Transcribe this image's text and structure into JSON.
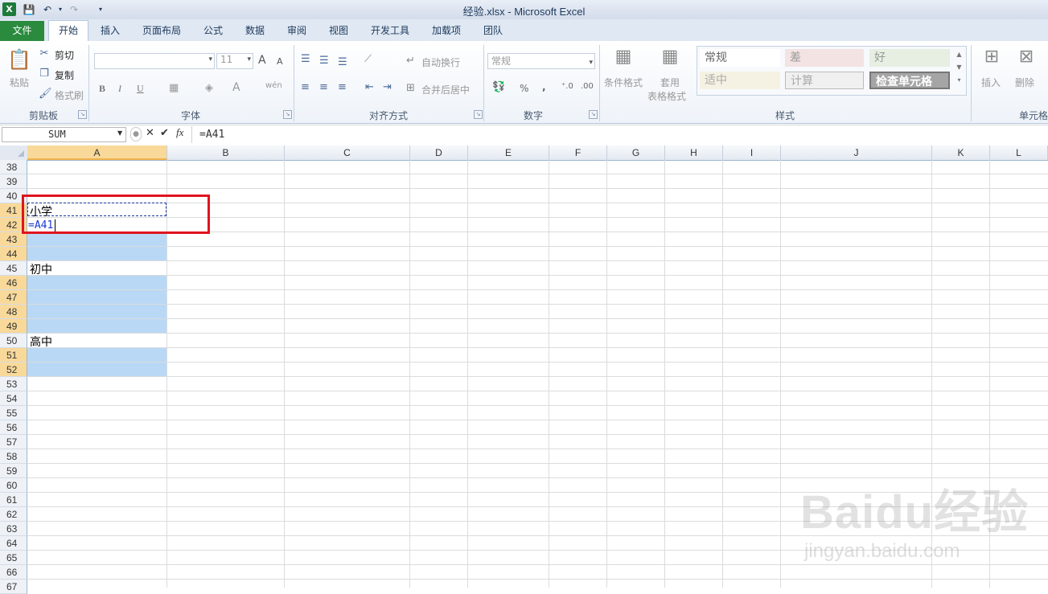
{
  "window": {
    "title": "经验.xlsx - Microsoft Excel"
  },
  "quick_access": {
    "logo": "X",
    "save": "💾",
    "undo": "↶",
    "redo": "↷"
  },
  "tabs": [
    "文件",
    "开始",
    "插入",
    "页面布局",
    "公式",
    "数据",
    "审阅",
    "视图",
    "开发工具",
    "加载项",
    "团队"
  ],
  "ribbon": {
    "clipboard": {
      "paste": "粘贴",
      "cut": "剪切",
      "copy": "复制",
      "format_painter": "格式刷",
      "label": "剪贴板"
    },
    "font": {
      "font_name": "",
      "font_size": "11",
      "bold": "B",
      "italic": "I",
      "underline": "U",
      "label": "字体",
      "grow": "A",
      "shrink": "A",
      "color_a": "A",
      "phonetic": "wén"
    },
    "alignment": {
      "wrap": "自动换行",
      "merge": "合并后居中",
      "label": "对齐方式"
    },
    "number": {
      "format": "常规",
      "percent": "%",
      "comma": ",",
      "label": "数字"
    },
    "styles": {
      "conditional": "条件格式",
      "table": "套用",
      "table2": "表格格式",
      "normal": "常规",
      "bad": "差",
      "good": "好",
      "neutral": "适中",
      "calc": "计算",
      "check": "检查单元格",
      "label": "样式"
    },
    "cells": {
      "insert": "插入",
      "delete": "删除",
      "label": "单元格"
    }
  },
  "formula_bar": {
    "name_box": "SUM",
    "cancel": "✕",
    "enter": "✔",
    "fx": "fx",
    "formula": "=A41"
  },
  "columns": [
    "A",
    "B",
    "C",
    "D",
    "E",
    "F",
    "G",
    "H",
    "I",
    "J",
    "K",
    "L"
  ],
  "rows": [
    "38",
    "39",
    "40",
    "41",
    "42",
    "43",
    "44",
    "45",
    "46",
    "47",
    "48",
    "49",
    "50",
    "51",
    "52",
    "53",
    "54",
    "55",
    "56",
    "57",
    "58",
    "59",
    "60",
    "61",
    "62",
    "63",
    "64",
    "65",
    "66",
    "67"
  ],
  "cells": {
    "A41": "小学",
    "A42": "=A41",
    "A45": "初中",
    "A50": "高中"
  },
  "colors": {
    "selection_fill": "#b9d8f5",
    "highlight_box": "#e0141e",
    "file_tab": "#2a8a3e"
  },
  "watermark": {
    "brand": "Baidu经验",
    "url": "jingyan.baidu.com"
  }
}
